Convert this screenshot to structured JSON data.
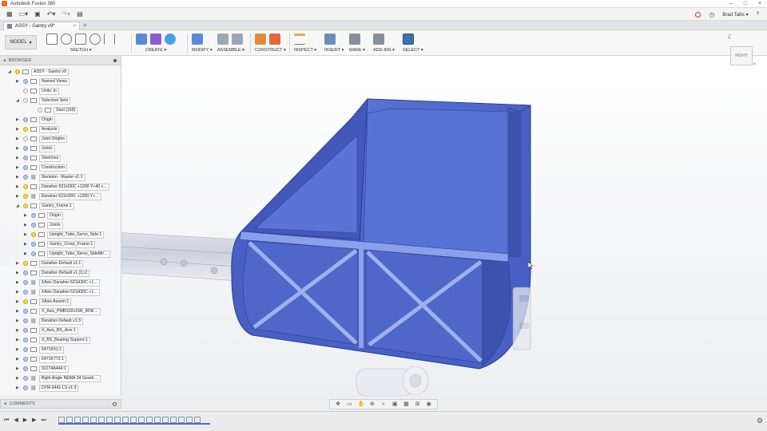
{
  "window": {
    "title": "Autodesk Fusion 360",
    "controls": [
      "–",
      "□",
      "×"
    ]
  },
  "quick_access": {
    "items": [
      "grid-icon",
      "file-icon",
      "save-icon",
      "undo-icon",
      "redo-icon",
      "data-icon"
    ],
    "user": "Brad Tallis",
    "user_caret": "▾",
    "help": "?"
  },
  "document_tab": {
    "title": "ASSY - Gantry v9*",
    "close": "×",
    "new_tab": "+"
  },
  "toolbar": {
    "workspace": "MODEL",
    "workspace_caret": "▾",
    "groups": [
      {
        "label": "SKETCH ▾"
      },
      {
        "label": "CREATE ▾"
      },
      {
        "label": "MODIFY ▾"
      },
      {
        "label": "ASSEMBLE ▾"
      },
      {
        "label": "CONSTRUCT ▾"
      },
      {
        "label": "INSPECT ▾"
      },
      {
        "label": "INSERT ▾"
      },
      {
        "label": "MAKE ▾"
      },
      {
        "label": "ADD-INS ▾"
      },
      {
        "label": "SELECT ▾"
      }
    ]
  },
  "browser": {
    "title": "BROWSER",
    "collapse": "◂",
    "items": [
      {
        "label": "ASSY - Gantry v9",
        "arrow": "◢"
      },
      {
        "label": "Named Views",
        "arrow": "▶"
      },
      {
        "label": "Units: in",
        "arrow": ""
      },
      {
        "label": "Selection Sets",
        "arrow": "◢"
      },
      {
        "label": "Start [169]",
        "arrow": ""
      },
      {
        "label": "Origin",
        "arrow": "▶"
      },
      {
        "label": "Analysis",
        "arrow": "▶"
      },
      {
        "label": "Joint Origins",
        "arrow": "▶"
      },
      {
        "label": "Joints",
        "arrow": "▶"
      },
      {
        "label": "Sketches",
        "arrow": "▶"
      },
      {
        "label": "Construction",
        "arrow": "▶"
      },
      {
        "label": "Skeleton - Master v1:1",
        "arrow": "▶"
      },
      {
        "label": "Danaher-521H30C +1200 Y+40 v…",
        "arrow": "▶"
      },
      {
        "label": "Danaher-521H30C +1200 Y+…",
        "arrow": "▶"
      },
      {
        "label": "Gantry_Frame:1",
        "arrow": "◢"
      },
      {
        "label": "Origin",
        "arrow": "▶"
      },
      {
        "label": "Joints",
        "arrow": "▶"
      },
      {
        "label": "Upright_Tube_Servo_Side:1",
        "arrow": "▶"
      },
      {
        "label": "Gantry_Cross_Frame:1",
        "arrow": "▶"
      },
      {
        "label": "Upright_Tube_Servo_SideMir…",
        "arrow": "▶"
      },
      {
        "label": "Danaher-Default v1:1",
        "arrow": "▶"
      },
      {
        "label": "Danaher-Default v1 (1):2",
        "arrow": "▶"
      },
      {
        "label": "XAxis Danaher-521H30C +1…",
        "arrow": "▶"
      },
      {
        "label": "XAxis Danaher-521H30C +1…",
        "arrow": "▶"
      },
      {
        "label": "ZAxis Assem:1",
        "arrow": "▶"
      },
      {
        "label": "X_Axis_PMBS32x15R_4FW…",
        "arrow": "▶"
      },
      {
        "label": "Danaher-Default v1:3",
        "arrow": "▶"
      },
      {
        "label": "X_Axis_BS_Arm:1",
        "arrow": "▶"
      },
      {
        "label": "X_BS_Bearing Support:1",
        "arrow": "▶"
      },
      {
        "label": "6471K51:1",
        "arrow": "▶"
      },
      {
        "label": "6471K772:1",
        "arrow": "▶"
      },
      {
        "label": "91274A444:1",
        "arrow": "▶"
      },
      {
        "label": "Right Angle NEMA 34 Gearb…",
        "arrow": "▶"
      },
      {
        "label": "CFM-3441-LS v1:3",
        "arrow": "▶"
      }
    ]
  },
  "comments": {
    "title": "COMMENTS",
    "collapse": "◂"
  },
  "viewcube": {
    "face": "RIGHT",
    "axis": "Z",
    "close": "×"
  },
  "colors": {
    "part_blue": "#4a63c6",
    "part_blue_dark": "#3248a3",
    "part_blue_light": "#6b84de",
    "timeline_accent": "#4f6ac4"
  },
  "timeline": {
    "controls": [
      "⏮",
      "◀",
      "▶",
      "▶",
      "⏭"
    ],
    "settings": "⚙"
  }
}
